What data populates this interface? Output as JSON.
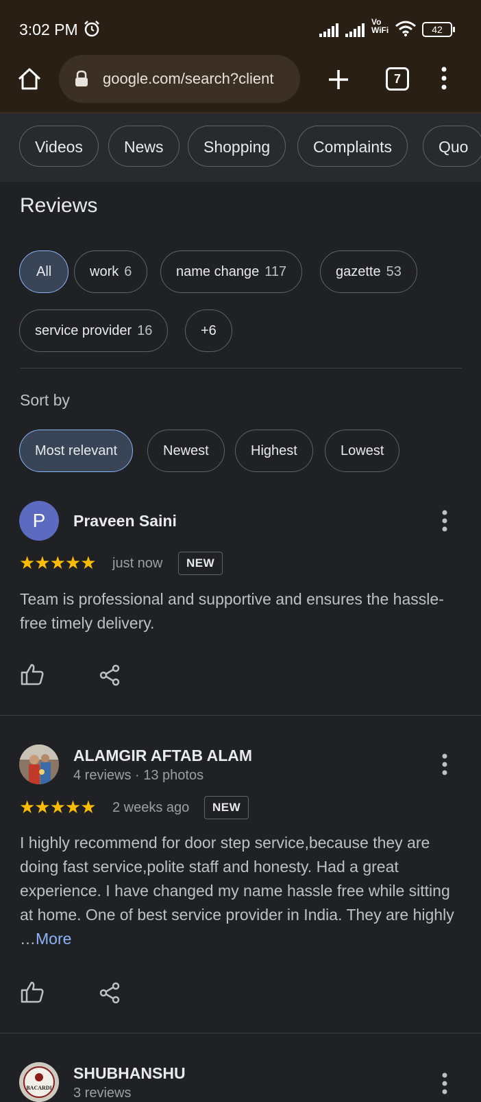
{
  "status_bar": {
    "time": "3:02 PM",
    "vowifi_line1": "Vo",
    "vowifi_line2": "WiFi",
    "battery": "42"
  },
  "browser": {
    "url": "google.com/search?client",
    "tab_count": "7"
  },
  "search_tabs": [
    "Videos",
    "News",
    "Shopping",
    "Complaints",
    "Quo"
  ],
  "reviews": {
    "title": "Reviews",
    "filters": [
      {
        "label": "All",
        "count": ""
      },
      {
        "label": "work",
        "count": "6"
      },
      {
        "label": "name change",
        "count": "117"
      },
      {
        "label": "gazette",
        "count": "53"
      },
      {
        "label": "service provider",
        "count": "16"
      },
      {
        "label": "+6",
        "count": ""
      }
    ],
    "sort_label": "Sort by",
    "sort_options": [
      "Most relevant",
      "Newest",
      "Highest",
      "Lowest"
    ],
    "items": [
      {
        "avatar_letter": "P",
        "name": "Praveen Saini",
        "meta": "",
        "stars": "★★★★★",
        "time": "just now",
        "badge": "NEW",
        "text": "Team is professional and supportive and ensures the hassle-free timely delivery.",
        "more": ""
      },
      {
        "avatar_letter": "",
        "name": "ALAMGIR AFTAB ALAM",
        "meta": "4 reviews · 13 photos",
        "stars": "★★★★★",
        "time": "2 weeks ago",
        "badge": "NEW",
        "text": "I highly recommend for door step service,because they are doing fast service,polite staff and honesty. Had a great experience. I have changed my name hassle free while sitting at home. One of best service provider in India. They are highly …",
        "more": "More"
      },
      {
        "avatar_letter": "",
        "name": "SHUBHANSHU",
        "meta": "3 reviews",
        "avatar_text": "BACARDI"
      }
    ]
  },
  "colors": {
    "chrome_bar": "#2a1f15",
    "background": "#202124",
    "accent_blue": "#8ab4f8",
    "star": "#fbbc04",
    "avatar_p": "#5c6bc0"
  }
}
